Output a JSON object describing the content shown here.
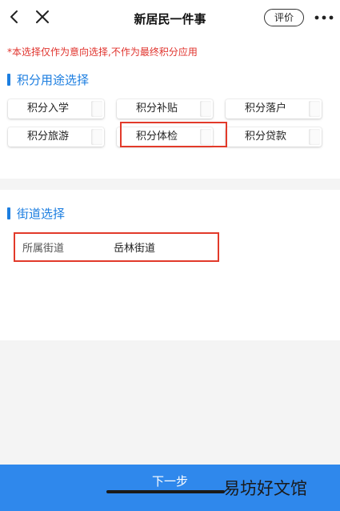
{
  "header": {
    "title": "新居民一件事",
    "rate_label": "评价"
  },
  "notice": "*本选择仅作为意向选择,不作为最终积分应用",
  "purpose_section": {
    "title": "积分用途选择",
    "options": [
      "积分入学",
      "积分补贴",
      "积分落户",
      "积分旅游",
      "积分体检",
      "积分贷款"
    ],
    "selected": "积分体检"
  },
  "street_section": {
    "title": "街道选择",
    "field_label": "所属街道",
    "field_value": "岳林街道"
  },
  "footer": {
    "next_label": "下一步",
    "watermark": "易坊好文馆"
  },
  "colors": {
    "accent": "#1c7ee0",
    "notice": "#e0332d",
    "highlight_box": "#e23a2a",
    "footer_bg": "#2f88ec"
  }
}
